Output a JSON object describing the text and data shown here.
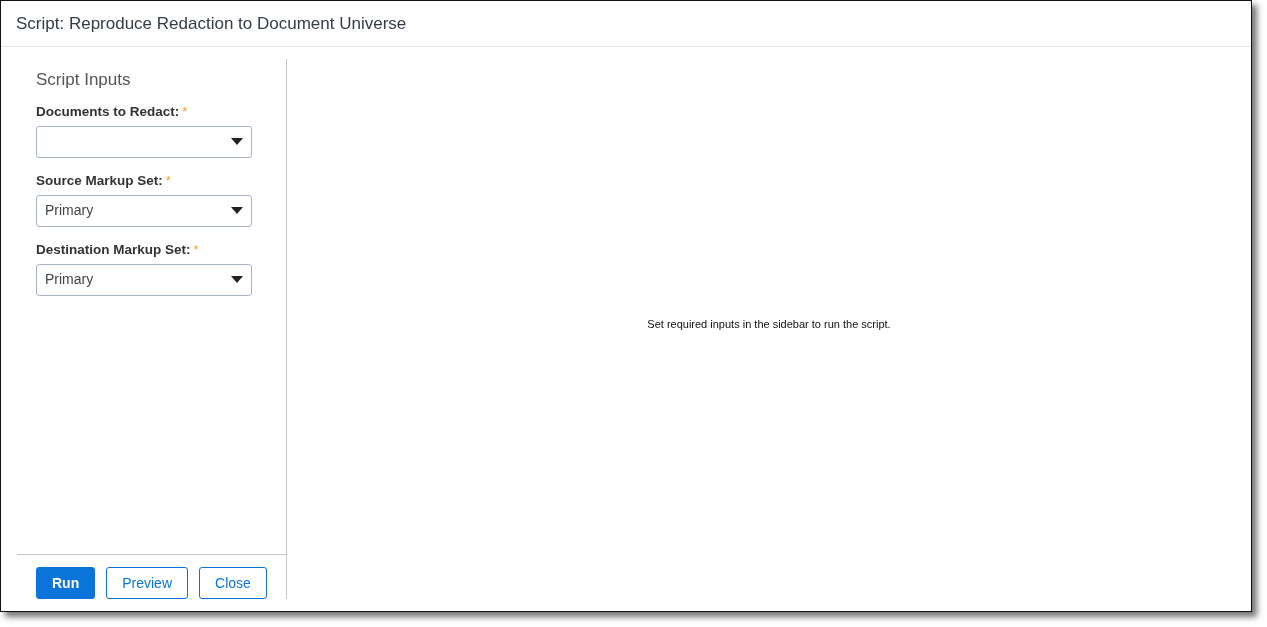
{
  "window": {
    "title": "Script: Reproduce Redaction to Document Universe"
  },
  "sidebar": {
    "heading": "Script Inputs",
    "fields": [
      {
        "label": "Documents to Redact:",
        "required_mark": "*"
      },
      {
        "label": "Source Markup Set:",
        "required_mark": "*",
        "value": "Primary"
      },
      {
        "label": "Destination Markup Set:",
        "required_mark": "*",
        "value": "Primary"
      }
    ],
    "buttons": [
      {
        "label": "Run",
        "kind": "primary"
      },
      {
        "label": "Preview",
        "kind": "outline"
      },
      {
        "label": "Close",
        "kind": "outline"
      }
    ]
  },
  "main": {
    "message": "Set required inputs in the sidebar to run the script."
  }
}
